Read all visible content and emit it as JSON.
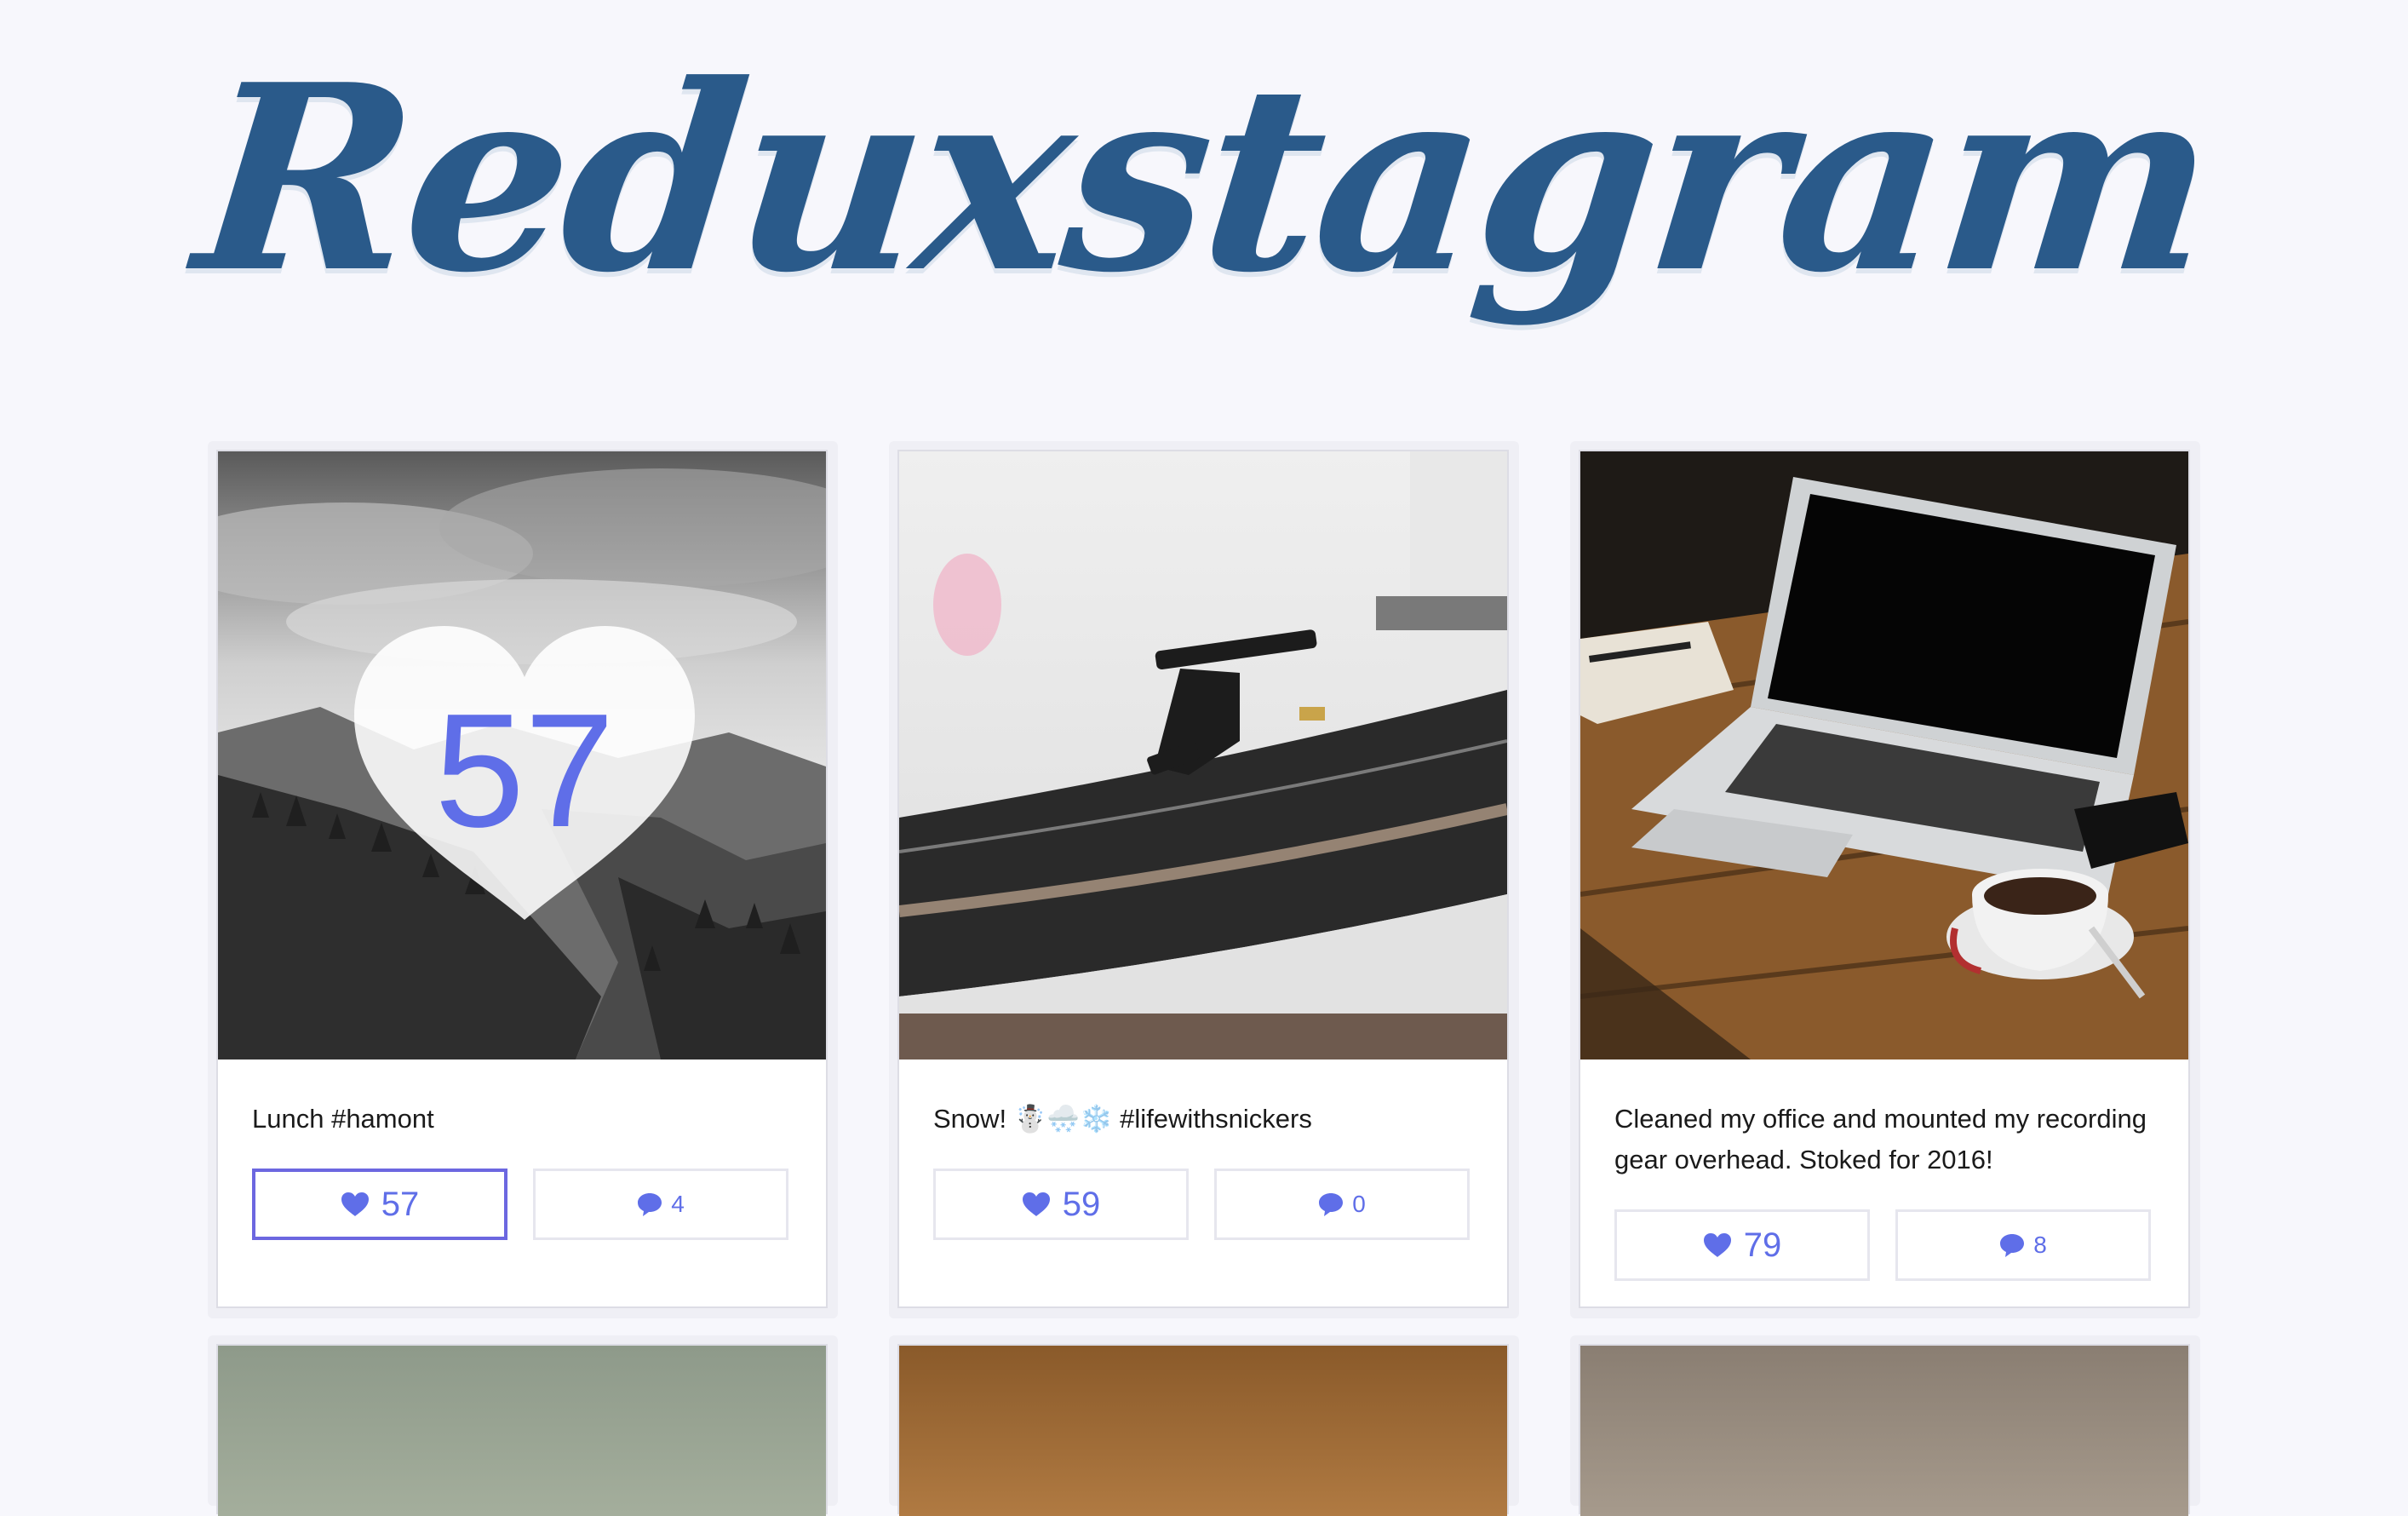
{
  "app": {
    "logo_text": "Reduxstagram",
    "accent_color": "#5f6ee8",
    "logo_color": "#2a5a8a"
  },
  "posts": [
    {
      "caption": "Lunch #hamont",
      "likes": "57",
      "comments": "4",
      "overlay_likes": "57",
      "like_icon": "heart-icon",
      "comment_icon": "speech-bubble-icon"
    },
    {
      "caption": "Snow! ☃️🌨️❄️ #lifewithsnickers",
      "likes": "59",
      "comments": "0",
      "like_icon": "heart-icon",
      "comment_icon": "speech-bubble-icon"
    },
    {
      "caption": "Cleaned my office and mounted my recording gear overhead. Stoked for 2016!",
      "likes": "79",
      "comments": "8",
      "like_icon": "heart-icon",
      "comment_icon": "speech-bubble-icon"
    }
  ]
}
